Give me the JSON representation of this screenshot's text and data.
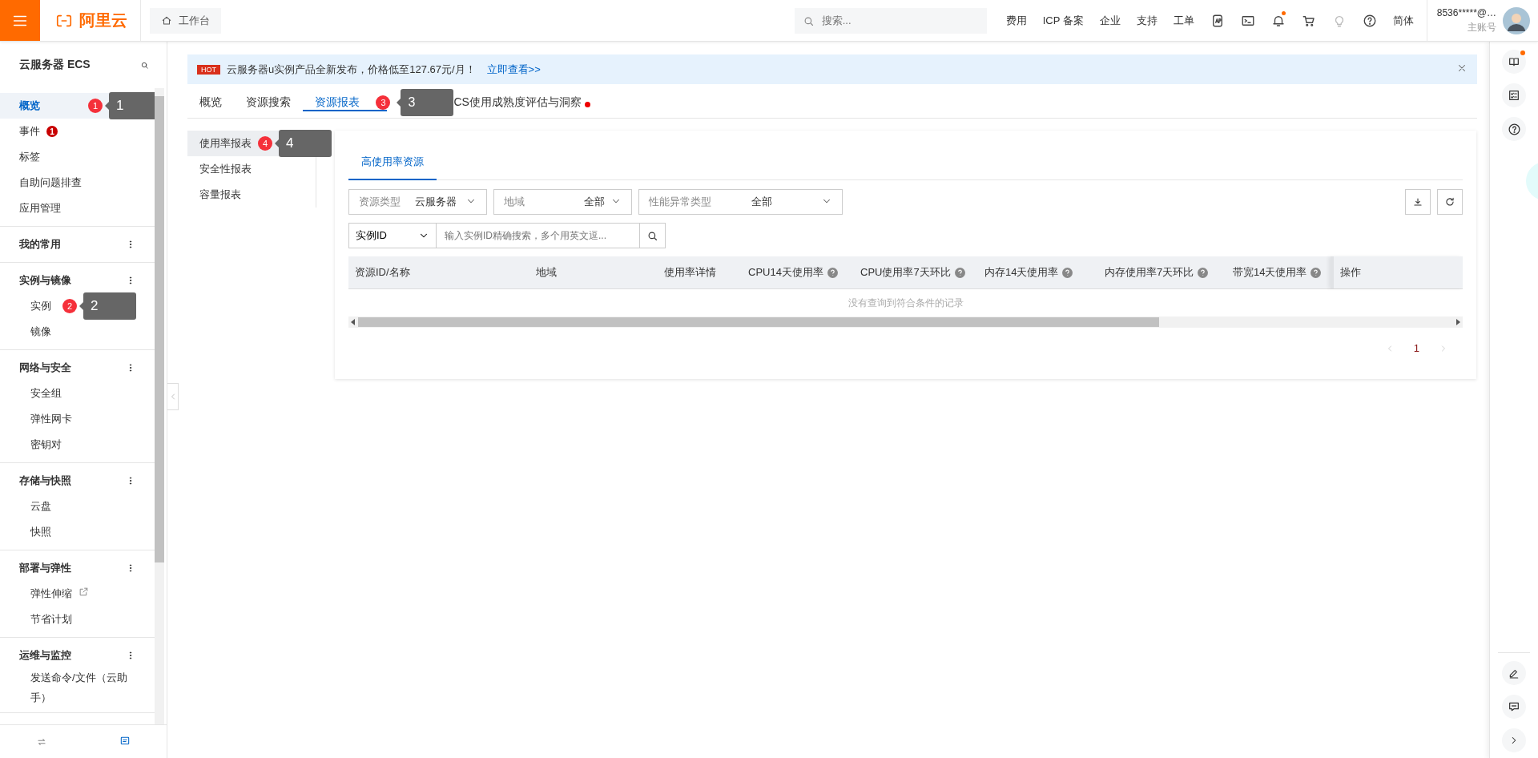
{
  "top_bar": {
    "logo": "阿里云",
    "workbench": "工作台",
    "search": {
      "placeholder": "搜索..."
    },
    "links": [
      "费用",
      "ICP 备案",
      "企业",
      "支持",
      "工单"
    ],
    "tools": [
      {
        "kind": "api",
        "dot": false
      },
      {
        "kind": "terminal",
        "dot": false
      },
      {
        "kind": "bell",
        "dot": true
      },
      {
        "kind": "cart",
        "dot": false
      },
      {
        "kind": "bulb",
        "dot": false
      },
      {
        "kind": "help",
        "dot": false
      }
    ],
    "language": "简体",
    "account": {
      "name": "8536*****@…",
      "type": "主账号"
    }
  },
  "sidebar": {
    "title": "云服务器 ECS",
    "groups": [
      {
        "items": [
          {
            "label": "概览",
            "selected": true,
            "external": false,
            "marker": "1",
            "callout": "1"
          },
          {
            "label": "事件",
            "selected": false,
            "external": false,
            "badge": "1"
          },
          {
            "label": "标签",
            "selected": false,
            "external": false
          },
          {
            "label": "自助问题排查",
            "selected": false,
            "external": false
          },
          {
            "label": "应用管理",
            "selected": false,
            "external": false
          }
        ]
      },
      {
        "title": "我的常用"
      },
      {
        "title": "实例与镜像",
        "items": [
          {
            "label": "实例",
            "selected": false,
            "external": false,
            "marker": "2",
            "callout": "2"
          },
          {
            "label": "镜像",
            "selected": false,
            "external": false
          }
        ]
      },
      {
        "title": "网络与安全",
        "items": [
          {
            "label": "安全组",
            "selected": false,
            "external": false
          },
          {
            "label": "弹性网卡",
            "selected": false,
            "external": false
          },
          {
            "label": "密钥对",
            "selected": false,
            "external": false
          }
        ]
      },
      {
        "title": "存储与快照",
        "items": [
          {
            "label": "云盘",
            "selected": false,
            "external": false
          },
          {
            "label": "快照",
            "selected": false,
            "external": false
          }
        ]
      },
      {
        "title": "部署与弹性",
        "items": [
          {
            "label": "弹性伸缩",
            "selected": false,
            "external": true
          },
          {
            "label": "节省计划",
            "selected": false,
            "external": false
          }
        ]
      },
      {
        "title": "运维与监控",
        "items": [
          {
            "label": "发送命令/文件（云助手）",
            "selected": false,
            "external": false
          }
        ]
      }
    ]
  },
  "banner": {
    "tag": "HOT",
    "text": "云服务器u实例产品全新发布，价格低至127.67元/月！",
    "link": "立即查看>>"
  },
  "tabs": [
    {
      "label": "概览",
      "selected": false,
      "dot": false
    },
    {
      "label": "资源搜索",
      "selected": false,
      "dot": false
    },
    {
      "label": "资源报表",
      "selected": true,
      "dot": false,
      "marker": "3",
      "callout": "3"
    },
    {
      "label": "CS使用成熟度评估与洞察",
      "selected": false,
      "dot": true
    }
  ],
  "report_nav": [
    {
      "label": "使用率报表",
      "selected": true,
      "marker": "4",
      "callout": "4"
    },
    {
      "label": "安全性报表",
      "selected": false
    },
    {
      "label": "容量报表",
      "selected": false
    }
  ],
  "card": {
    "tabs": [
      {
        "label": "高使用率资源",
        "selected": true
      }
    ],
    "filters": [
      {
        "label": "资源类型",
        "value": "云服务器"
      },
      {
        "label": "地域",
        "value": "全部"
      },
      {
        "label": "性能异常类型",
        "value": "全部"
      }
    ],
    "search": {
      "field": "实例ID",
      "placeholder": "输入实例ID精确搜索，多个用英文逗..."
    },
    "table": {
      "columns": [
        {
          "label": "资源ID/名称",
          "help": false
        },
        {
          "label": "地域",
          "help": false
        },
        {
          "label": "使用率详情",
          "help": false
        },
        {
          "label": "CPU14天使用率",
          "help": true
        },
        {
          "label": "CPU使用率7天环比",
          "help": true
        },
        {
          "label": "内存14天使用率",
          "help": true
        },
        {
          "label": "内存使用率7天环比",
          "help": true
        },
        {
          "label": "带宽14天使用率",
          "help": true
        },
        {
          "label": "操作",
          "help": false
        }
      ],
      "empty": "没有查询到符合条件的记录"
    },
    "pagination": {
      "pages": [
        {
          "label": "1",
          "selected": true
        }
      ]
    }
  }
}
